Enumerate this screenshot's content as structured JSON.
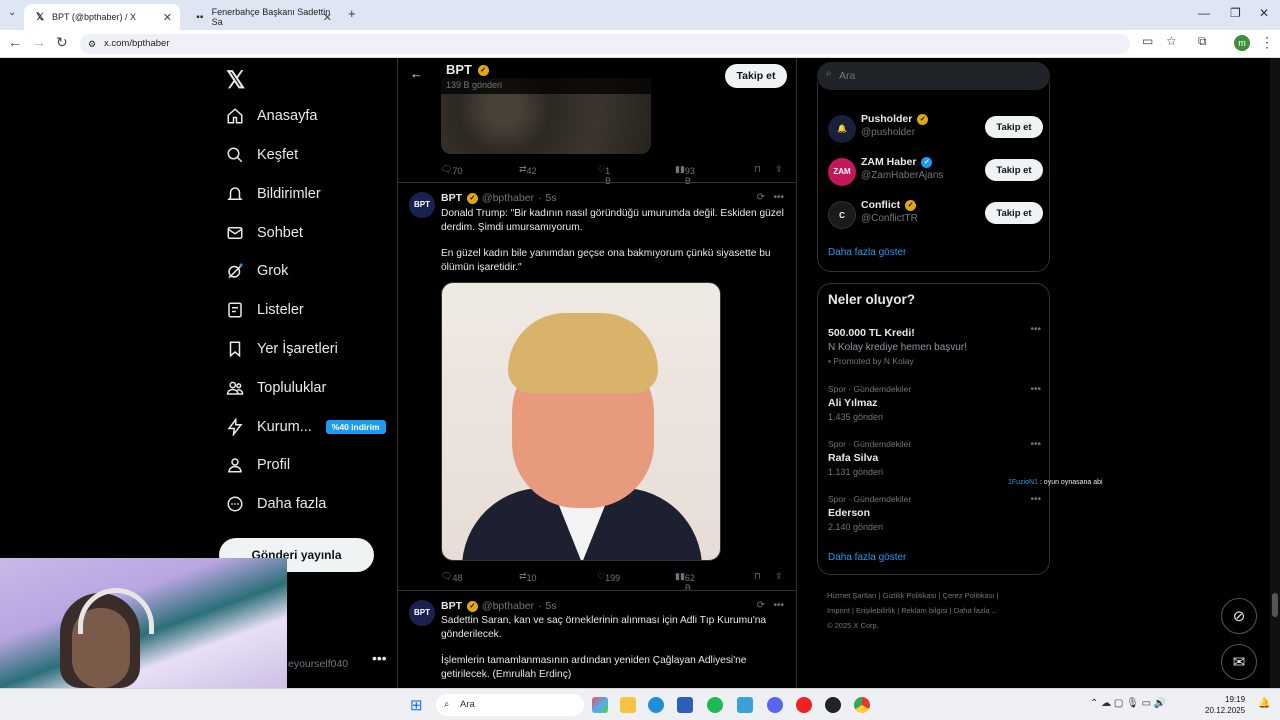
{
  "browser": {
    "tabs": [
      {
        "title": "BPT (@bpthaber) / X",
        "active": true
      },
      {
        "title": "Fenerbahçe Başkanı Sadettin Sa",
        "active": false
      }
    ],
    "url": "x.com/bpthaber",
    "profile_letter": "m"
  },
  "nav": {
    "items": [
      {
        "label": "Anasayfa",
        "icon": "home-icon"
      },
      {
        "label": "Keşfet",
        "icon": "search-icon"
      },
      {
        "label": "Bildirimler",
        "icon": "bell-icon"
      },
      {
        "label": "Sohbet",
        "icon": "mail-icon"
      },
      {
        "label": "Grok",
        "icon": "grok-icon"
      },
      {
        "label": "Listeler",
        "icon": "list-icon"
      },
      {
        "label": "Yer İşaretleri",
        "icon": "bookmark-icon"
      },
      {
        "label": "Topluluklar",
        "icon": "people-icon"
      },
      {
        "label": "Kurum...",
        "icon": "bolt-icon",
        "badge": "%40 indirim"
      },
      {
        "label": "Profil",
        "icon": "person-icon"
      },
      {
        "label": "Daha fazla",
        "icon": "more-icon"
      }
    ],
    "post_button": "Gönderi yayınla",
    "user_handle": "eyourself040"
  },
  "profile_header": {
    "name": "BPT",
    "post_count": "139 B gönderi",
    "follow_label": "Takip et"
  },
  "tweets": [
    {
      "replies": "70",
      "retweets": "42",
      "likes": "1 B",
      "views": "93 B"
    },
    {
      "name": "BPT",
      "handle": "@bpthaber",
      "time": "5s",
      "avatar": "BPT",
      "text1": "Donald Trump: \"Bir kadının nasıl göründüğü umurumda değil. Eskiden güzel derdim. Şimdi umursamıyorum.",
      "text2": "En güzel kadın bile yanımdan geçse ona bakmıyorum çünkü siyasette bu ölümün işaretidir.\"",
      "replies": "48",
      "retweets": "10",
      "likes": "199",
      "views": "62 B"
    },
    {
      "name": "BPT",
      "handle": "@bpthaber",
      "time": "5s",
      "avatar": "BPT",
      "text1": "Sadettin Saran, kan ve saç örneklerinin alınması için Adli Tıp Kurumu'na gönderilecek.",
      "text2": "İşlemlerin tamamlanmasının ardından yeniden Çağlayan Adliyesi'ne getirilecek. (Emrullah Erdinç)"
    }
  ],
  "search_placeholder": "Ara",
  "who_to_follow": {
    "accounts": [
      {
        "name": "Pusholder",
        "handle": "@pusholder",
        "avatar_color": "#1a1f3a",
        "verified": "gold"
      },
      {
        "name": "ZAM Haber",
        "handle": "@ZamHaberAjans",
        "avatar_color": "#c2185b",
        "verified": "blue"
      },
      {
        "name": "Conflict",
        "handle": "@ConflictTR",
        "avatar_color": "#1a1a1a",
        "verified": "gold"
      }
    ],
    "follow_label": "Takip et",
    "show_more": "Daha fazla göster"
  },
  "trends": {
    "title": "Neler oluyor?",
    "items": [
      {
        "category": "",
        "name": "500.000 TL Kredi!",
        "sub": "N Kolay krediye hemen başvur!",
        "extra": "Promoted by N Kolay"
      },
      {
        "category": "Spor · Gündemdekiler",
        "name": "Ali Yılmaz",
        "sub": "1.435 gönderi"
      },
      {
        "category": "Spor · Gündemdekiler",
        "name": "Rafa Silva",
        "sub": "1.131 gönderi"
      },
      {
        "category": "Spor · Gündemdekiler",
        "name": "Ederson",
        "sub": "2.140 gönderi"
      }
    ],
    "show_more": "Daha fazla göster"
  },
  "footer": {
    "line1": "Hizmet Şartları  |  Gizlilik Politikası  |  Çerez Politikası  |",
    "line2": "Imprint  |  Erişilebilirlik  |  Reklam bilgisi  |  Daha fazla ...",
    "line3": "© 2025 X Corp."
  },
  "overlay_chat": {
    "user": "1FuzioN1",
    "message": ": oyun oynasana abi"
  },
  "taskbar": {
    "search": "Ara",
    "time": "19:19",
    "date": "20.12.2025"
  }
}
